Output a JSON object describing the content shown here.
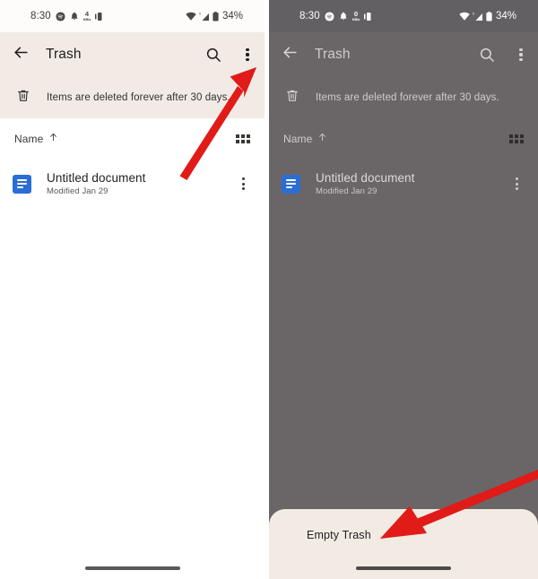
{
  "meta": {
    "accent_red": "#E01B18",
    "appbar_bg": "#F2EBE5",
    "sheet_bg": "#F2EBE4",
    "scrim_bg": "#6A6668",
    "doc_icon_blue": "#2A6ED4"
  },
  "status_bar": {
    "time": "8:30",
    "data_rate_value": "4",
    "data_rate_unit": "KB/s",
    "data_rate_value_right": "0",
    "battery_percent": "34%",
    "icons": [
      "spotify-icon",
      "bell-icon",
      "data-rate-icon",
      "vibrate-icon",
      "wifi-icon",
      "signal-icon",
      "battery-icon"
    ]
  },
  "panels": [
    {
      "id": "before",
      "app_bar": {
        "back_label": "Back",
        "title": "Trash",
        "search_label": "Search",
        "overflow_label": "More options"
      },
      "info_strip": {
        "icon": "trash-icon",
        "text": "Items are deleted forever after 30 days."
      },
      "sort_row": {
        "label": "Name",
        "direction_icon": "arrow-up-icon",
        "view_toggle": "grid-view-icon"
      },
      "files": [
        {
          "icon": "google-docs-icon",
          "name": "Untitled document",
          "subtitle": "Modified Jan 29",
          "menu": "item-overflow-icon"
        }
      ],
      "sheet": null
    },
    {
      "id": "after",
      "app_bar": {
        "back_label": "Back",
        "title": "Trash",
        "search_label": "Search",
        "overflow_label": "More options"
      },
      "info_strip": {
        "icon": "trash-icon",
        "text": "Items are deleted forever after 30 days."
      },
      "sort_row": {
        "label": "Name",
        "direction_icon": "arrow-up-icon",
        "view_toggle": "grid-view-icon"
      },
      "files": [
        {
          "icon": "google-docs-icon",
          "name": "Untitled document",
          "subtitle": "Modified Jan 29",
          "menu": "item-overflow-icon"
        }
      ],
      "sheet": {
        "option_label": "Empty Trash"
      }
    }
  ],
  "annotations": [
    {
      "name": "arrow-to-overflow-menu",
      "color": "#E01B18"
    },
    {
      "name": "arrow-to-empty-trash",
      "color": "#E01B18"
    }
  ]
}
